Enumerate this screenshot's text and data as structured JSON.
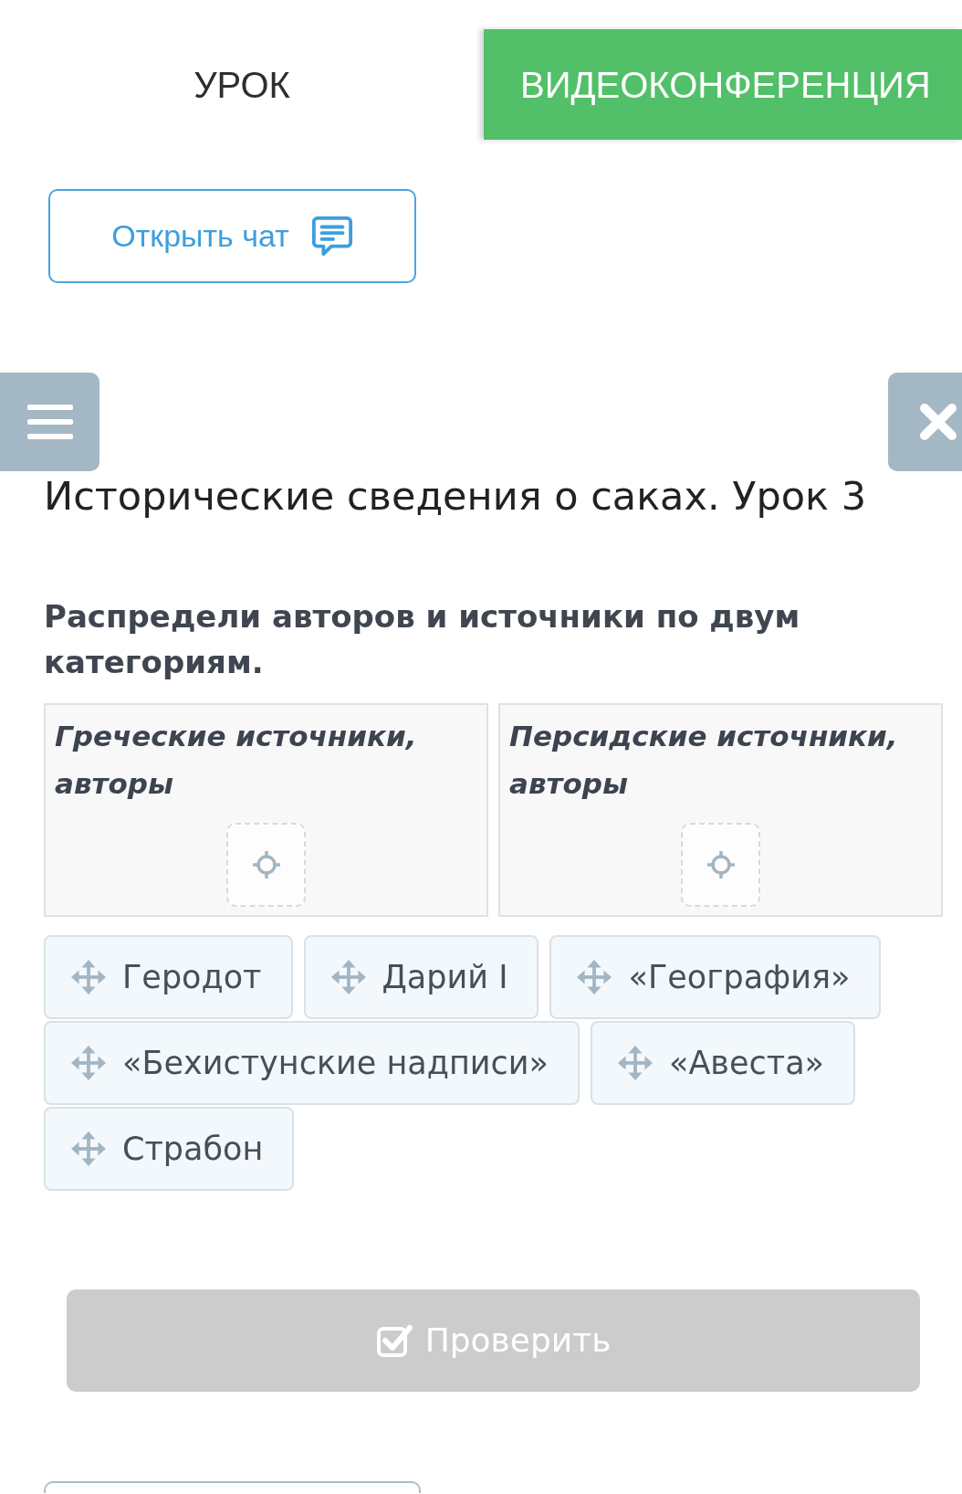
{
  "tabs": [
    {
      "label": "УРОК",
      "selected": false
    },
    {
      "label": "ВИДЕОКОНФЕРЕНЦИЯ",
      "selected": true
    }
  ],
  "chat_button": {
    "label": "Открыть чат"
  },
  "lesson": {
    "title": "Исторические сведения о саках. Урок 3"
  },
  "task": {
    "instruction": "Распредели авторов и источники по двум категориям.",
    "categories": [
      {
        "title": "Греческие источники, авторы"
      },
      {
        "title": "Персидские источники, авторы"
      }
    ],
    "items": [
      {
        "label": "Геродот"
      },
      {
        "label": "Дарий I"
      },
      {
        "label": "«География»"
      },
      {
        "label": "«Бехистунские надписи»"
      },
      {
        "label": "«Авеста»"
      },
      {
        "label": "Страбон"
      }
    ]
  },
  "check_button": {
    "label": "Проверить",
    "disabled": true
  }
}
